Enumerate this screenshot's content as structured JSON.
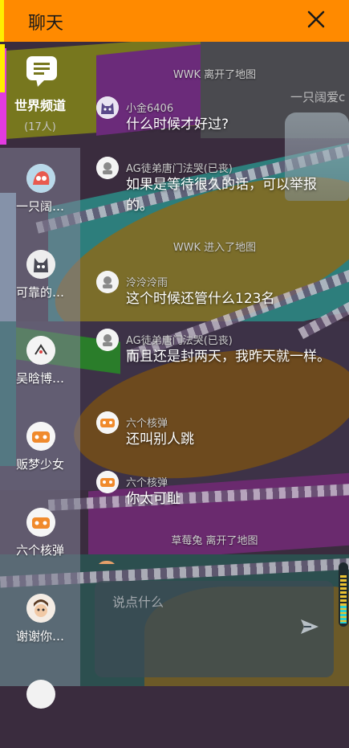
{
  "header": {
    "title": "聊天"
  },
  "world": {
    "label": "世界频道",
    "count": "(17人)"
  },
  "users": [
    {
      "name": "一只阔…"
    },
    {
      "name": "可靠的…"
    },
    {
      "name": "吴晗博…"
    },
    {
      "name": "贩梦少女"
    },
    {
      "name": "六个核弹"
    },
    {
      "name": "谢谢你…"
    }
  ],
  "scene": {
    "player_name": "一只阔爱c"
  },
  "messages": [
    {
      "type": "system",
      "text": "WWK 离开了地图"
    },
    {
      "type": "chat",
      "sender": "小金6406",
      "text": "什么时候才好过?"
    },
    {
      "type": "chat",
      "sender": "AG徒弟唐门法哭(已丧)",
      "text": "如果是等待很久的话，可以举报的。"
    },
    {
      "type": "system",
      "text": "WWK 进入了地图"
    },
    {
      "type": "chat",
      "sender": "泠泠泠雨",
      "text": "这个时候还管什么123名"
    },
    {
      "type": "chat",
      "sender": "AG徒弟唐门法哭(已丧)",
      "text": "而且还是封两天，我昨天就一样。"
    },
    {
      "type": "chat",
      "sender": "六个核弹",
      "text": "还叫别人跳"
    },
    {
      "type": "chat",
      "sender": "六个核弹",
      "text": "你太可耻"
    },
    {
      "type": "system",
      "text": "草莓兔 离开了地图"
    }
  ],
  "input": {
    "placeholder": "说点什么"
  },
  "colors": {
    "header_bg": "#ff8a00",
    "accent_strip": "#ffee00",
    "sidebar_bg": "#82829680"
  }
}
